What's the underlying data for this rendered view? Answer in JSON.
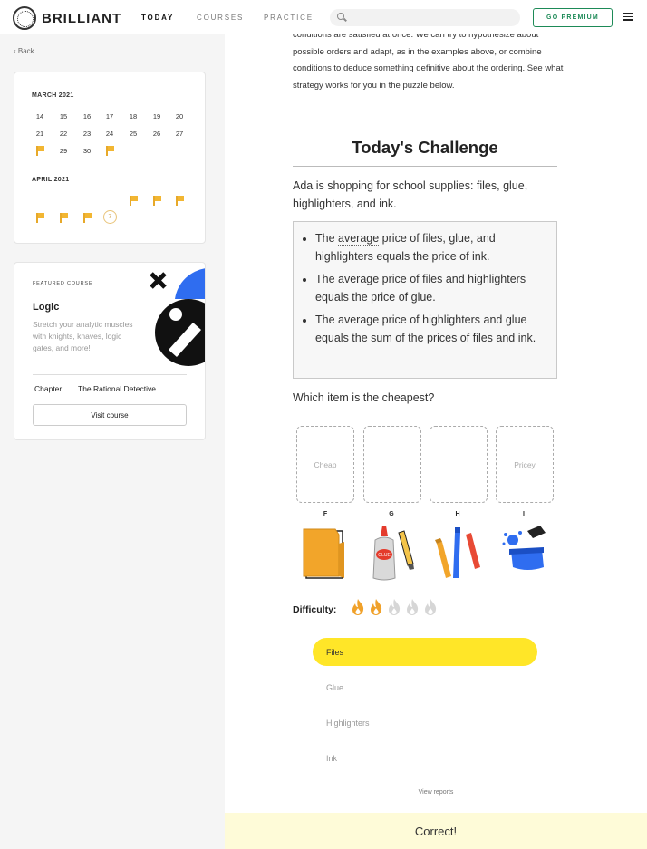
{
  "header": {
    "brand": "BRILLIANT",
    "nav": [
      "TODAY",
      "COURSES",
      "PRACTICE"
    ],
    "search_placeholder": "",
    "premium_label": "GO PREMIUM"
  },
  "sidebar": {
    "back_label": "Back",
    "calendar": {
      "march": {
        "label": "MARCH 2021",
        "rows": [
          [
            "14",
            "15",
            "16",
            "17",
            "18",
            "19",
            "20"
          ],
          [
            "21",
            "22",
            "23",
            "24",
            "25",
            "26",
            "27"
          ],
          [
            "flag",
            "29",
            "30",
            "flag",
            "",
            "",
            ""
          ]
        ]
      },
      "april": {
        "label": "APRIL 2021",
        "rows": [
          [
            "",
            "",
            "",
            "",
            "flag",
            "flag",
            "flag"
          ],
          [
            "flag",
            "flag",
            "flag",
            "7",
            "",
            "",
            ""
          ]
        ]
      },
      "flag_color": "#f2b632"
    },
    "featured": {
      "label": "FEATURED COURSE",
      "title": "Logic",
      "description": "Stretch your analytic muscles with knights, knaves, logic gates, and more!",
      "chapter_label": "Chapter:",
      "chapter_value": "The Rational Detective",
      "button_label": "Visit course"
    }
  },
  "main": {
    "intro": "conditions are satisfied at once. We can try to hypothesize about possible orders and adapt, as in the examples above, or combine conditions to deduce something definitive about the ordering. See what strategy works for you in the puzzle below.",
    "challenge_title": "Today's Challenge",
    "question": "Ada is shopping for school supplies: files, glue, highlighters, and ink.",
    "conditions": {
      "c1_before": "The ",
      "c1_link": "average",
      "c1_after": " price of files, glue, and highlighters equals the price of ink.",
      "c2": "The average price of files and highlighters equals the price of glue.",
      "c3": "The average price of highlighters and glue equals the sum of the prices of files and ink."
    },
    "ask": "Which item is the cheapest?",
    "slots": [
      "Cheap",
      "",
      "",
      "Pricey"
    ],
    "items": [
      "F",
      "G",
      "H",
      "I"
    ],
    "difficulty": {
      "label": "Difficulty:",
      "level": 2,
      "max": 5,
      "active_color": "#f0a12a",
      "inactive_color": "#d6d6d6"
    },
    "options": [
      "Files",
      "Glue",
      "Highlighters",
      "Ink"
    ],
    "selected_option": "Files",
    "view_reports": "View reports",
    "result": "Correct!"
  }
}
